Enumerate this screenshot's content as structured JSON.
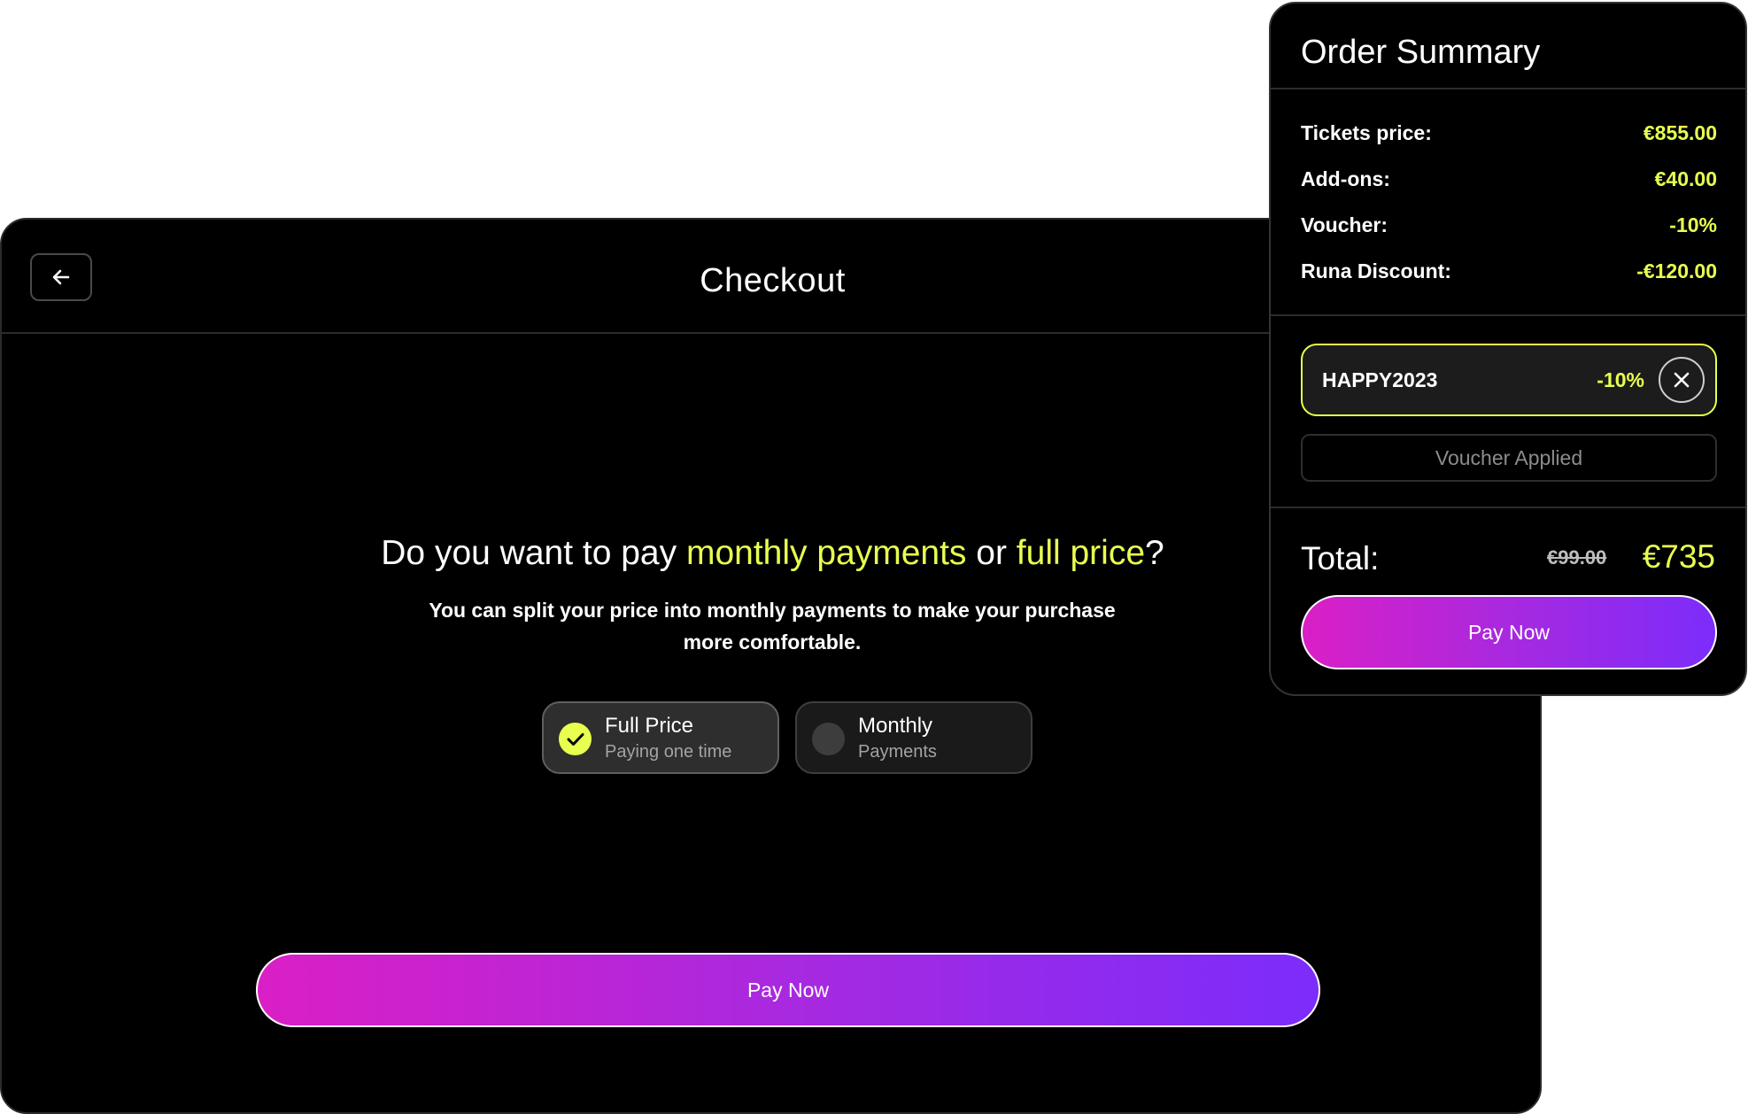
{
  "checkout": {
    "title": "Checkout",
    "question": {
      "part1": "Do you want to pay ",
      "highlight1": "monthly payments",
      "part2": " or ",
      "highlight2": "full price",
      "part3": "?"
    },
    "subtitle": "You can split your price into monthly payments to make your purchase more comfortable.",
    "options": [
      {
        "label": "Full Price",
        "sub": "Paying one time",
        "selected": true
      },
      {
        "label": "Monthly",
        "sub": "Payments",
        "selected": false
      }
    ],
    "pay_label": "Pay Now",
    "icons": {
      "back": "arrow-left-icon",
      "selected": "check-icon"
    }
  },
  "summary": {
    "title": "Order Summary",
    "rows": [
      {
        "label": "Tickets price:",
        "value": "€855.00"
      },
      {
        "label": "Add-ons:",
        "value": "€40.00"
      },
      {
        "label": "Voucher:",
        "value": "-10%"
      },
      {
        "label": "Runa Discount:",
        "value": "-€120.00"
      }
    ],
    "voucher": {
      "code": "HAPPY2023",
      "discount": "-10%",
      "status": "Voucher Applied"
    },
    "total": {
      "label": "Total:",
      "old": "€99.00",
      "new": "€735"
    },
    "pay_label": "Pay Now"
  },
  "colors": {
    "accent": "#e9ff4f",
    "gradient_start": "#da1fc6",
    "gradient_end": "#7c2cfb"
  }
}
